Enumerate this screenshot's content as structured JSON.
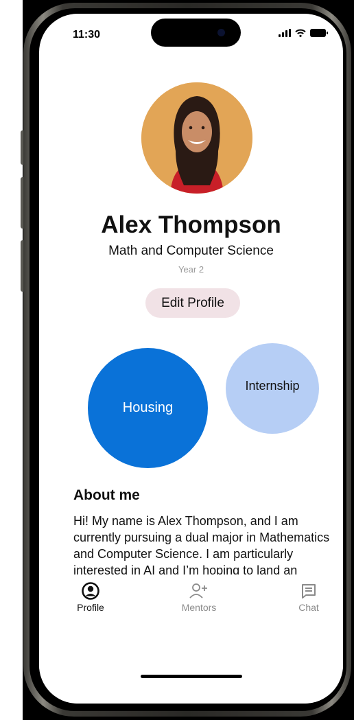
{
  "status_bar": {
    "time": "11:30"
  },
  "profile": {
    "name": "Alex Thompson",
    "major": "Math and Computer Science",
    "year": "Year 2",
    "edit_label": "Edit Profile"
  },
  "interests": [
    {
      "label": "Housing",
      "color": "#0a72d8"
    },
    {
      "label": "Internship",
      "color": "#b6cef5"
    }
  ],
  "about": {
    "title": "About me",
    "text": "Hi! My name is Alex Thompson, and I am currently pursuing a dual major in Mathematics and Computer Science. I am particularly interested in AI and I’m hoping to land an internship this summer in Toronto."
  },
  "tabs": [
    {
      "label": "Profile",
      "icon": "profile-icon",
      "active": true
    },
    {
      "label": "Mentors",
      "icon": "add-person-icon",
      "active": false
    },
    {
      "label": "Chat",
      "icon": "chat-icon",
      "active": false
    }
  ],
  "colors": {
    "accent": "#0a72d8",
    "edit_button_bg": "#f1e2e6"
  }
}
